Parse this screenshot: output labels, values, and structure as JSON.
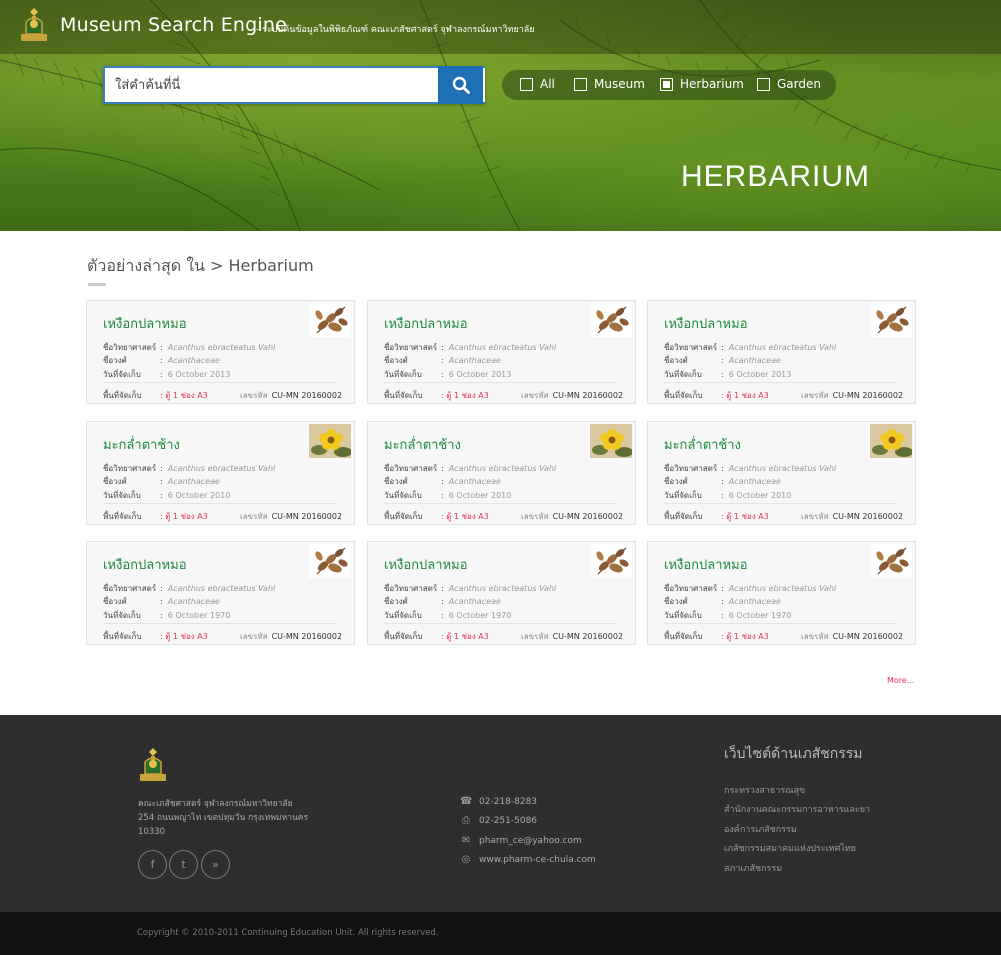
{
  "header": {
    "title": "Museum Search Engine",
    "subtitle": "- ระบบค้นข้อมูลในพิพิธภัณฑ์ คณะเภสัชศาสตร์ จุฬาลงกรณ์มหาวิทยาลัย"
  },
  "search": {
    "placeholder": "ใส่คำค้นที่นี่",
    "value": ""
  },
  "filters": [
    {
      "label": "All",
      "checked": false
    },
    {
      "label": "Museum",
      "checked": false
    },
    {
      "label": "Herbarium",
      "checked": true
    },
    {
      "label": "Garden",
      "checked": false
    }
  ],
  "hero": {
    "heading": "HERBARIUM"
  },
  "section": {
    "title": "ตัวอย่างล่าสุด ใน  >  Herbarium"
  },
  "card_labels": {
    "scientific": "ชื่อวิทยาศาสตร์",
    "family": "ชื่อวงศ์",
    "date": "วันที่จัดเก็บ",
    "location": "พื้นที่จัดเก็บ",
    "code": "เลขรหัส",
    "colon": ":"
  },
  "cards": [
    {
      "title": "เหงือกปลาหมอ",
      "scientific": "Acanthus ebracteatus Vahl",
      "family": "Acanthaceae",
      "date": "6 October  2013",
      "location": "ตู้ 1 ช่อง A3",
      "code": "CU-MN 20160002",
      "thumb": "dried-leaf"
    },
    {
      "title": "เหงือกปลาหมอ",
      "scientific": "Acanthus ebracteatus Vahl",
      "family": "Acanthaceae",
      "date": "6 October  2013",
      "location": "ตู้ 1 ช่อง A3",
      "code": "CU-MN 20160002",
      "thumb": "dried-leaf"
    },
    {
      "title": "เหงือกปลาหมอ",
      "scientific": "Acanthus ebracteatus Vahl",
      "family": "Acanthaceae",
      "date": "6 October  2013",
      "location": "ตู้ 1 ช่อง A3",
      "code": "CU-MN 20160002",
      "thumb": "dried-leaf"
    },
    {
      "title": "มะกล่ำตาช้าง",
      "scientific": "Acanthus ebracteatus Vahl",
      "family": "Acanthaceae",
      "date": "6 October  2010",
      "location": "ตู้ 1 ช่อง A3",
      "code": "CU-MN 20160002",
      "thumb": "yellow-flower"
    },
    {
      "title": "มะกล่ำตาช้าง",
      "scientific": "Acanthus ebracteatus Vahl",
      "family": "Acanthaceae",
      "date": "6 October  2010",
      "location": "ตู้ 1 ช่อง A3",
      "code": "CU-MN 20160002",
      "thumb": "yellow-flower"
    },
    {
      "title": "มะกล่ำตาช้าง",
      "scientific": "Acanthus ebracteatus Vahl",
      "family": "Acanthaceae",
      "date": "6 October  2010",
      "location": "ตู้ 1 ช่อง A3",
      "code": "CU-MN 20160002",
      "thumb": "yellow-flower"
    },
    {
      "title": "เหงือกปลาหมอ",
      "scientific": "Acanthus ebracteatus Vahl",
      "family": "Acanthaceae",
      "date": "6 October  1970",
      "location": "ตู้ 1 ช่อง A3",
      "code": "CU-MN 20160002",
      "thumb": "dried-leaf"
    },
    {
      "title": "เหงือกปลาหมอ",
      "scientific": "Acanthus ebracteatus Vahl",
      "family": "Acanthaceae",
      "date": "6 October  1970",
      "location": "ตู้ 1 ช่อง A3",
      "code": "CU-MN 20160002",
      "thumb": "dried-leaf"
    },
    {
      "title": "เหงือกปลาหมอ",
      "scientific": "Acanthus ebracteatus Vahl",
      "family": "Acanthaceae",
      "date": "6 October  1970",
      "location": "ตู้ 1 ช่อง A3",
      "code": "CU-MN 20160002",
      "thumb": "dried-leaf"
    }
  ],
  "more_label": "More...",
  "footer": {
    "address": [
      "คณะเภสัชศาสตร์ จุฬาลงกรณ์มหาวิทยาลัย",
      "254 ถนนพญาไท เขตปทุมวัน กรุงเทพมหานคร",
      "10330"
    ],
    "social": [
      {
        "icon": "facebook-icon",
        "glyph": "f"
      },
      {
        "icon": "twitter-icon",
        "glyph": "t"
      },
      {
        "icon": "rss-icon",
        "glyph": "»"
      }
    ],
    "contacts": [
      {
        "icon": "phone-icon",
        "glyph": "☎",
        "text": "02-218-8283"
      },
      {
        "icon": "fax-icon",
        "glyph": "⎙",
        "text": "02-251-5086"
      },
      {
        "icon": "mail-icon",
        "glyph": "✉",
        "text": "pharm_ce@yahoo.com"
      },
      {
        "icon": "globe-icon",
        "glyph": "◎",
        "text": "www.pharm-ce-chula.com"
      }
    ],
    "links_title": "เว็บไซต์ด้านเภสัชกรรม",
    "links": [
      "กระทรวงสาธารณสุข",
      "สำนักงานคณะกรรมการอาหารและยา",
      "องค์การเภสัชกรรม",
      "เภสัชกรรมสมาคมแห่งประเทศไทย",
      "สภาเภสัชกรรม"
    ],
    "copyright": "Copyright © 2010-2011 Continuing Education Unit. All rights reserved."
  },
  "colors": {
    "accent_green": "#1a8a3c",
    "search_blue": "#1f6fb5",
    "location_red": "#e0335d",
    "footer_bg": "#2e2e2e"
  }
}
